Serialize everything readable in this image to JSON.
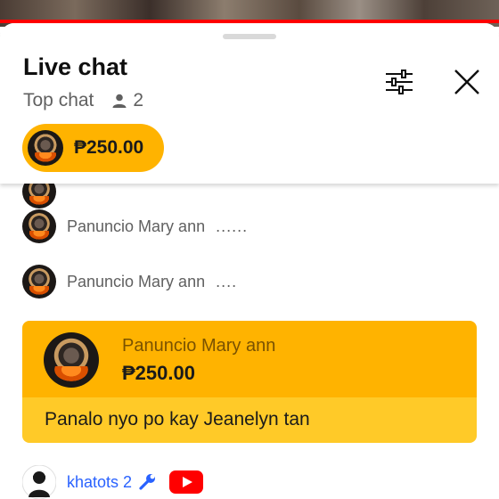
{
  "panel": {
    "title": "Live chat",
    "mode_label": "Top chat",
    "viewer_count": "2"
  },
  "ticker": {
    "amount": "₱250.00"
  },
  "messages": [
    {
      "author": "Panuncio Mary ann",
      "text": "......"
    },
    {
      "author": "Panuncio Mary ann",
      "text": "...."
    }
  ],
  "superchat": {
    "author": "Panuncio Mary ann",
    "amount": "₱250.00",
    "message": "Panalo nyo po kay Jeanelyn tan",
    "colors": {
      "header": "#ffb300",
      "body": "#ffca28"
    }
  },
  "last_message": {
    "author": "khatots 2"
  },
  "icons": [
    "person-icon",
    "filter-icon",
    "close-icon",
    "wrench-icon",
    "youtube-icon"
  ],
  "colors": {
    "accent_red": "#ff0000",
    "moderator_blue": "#2962ff"
  }
}
